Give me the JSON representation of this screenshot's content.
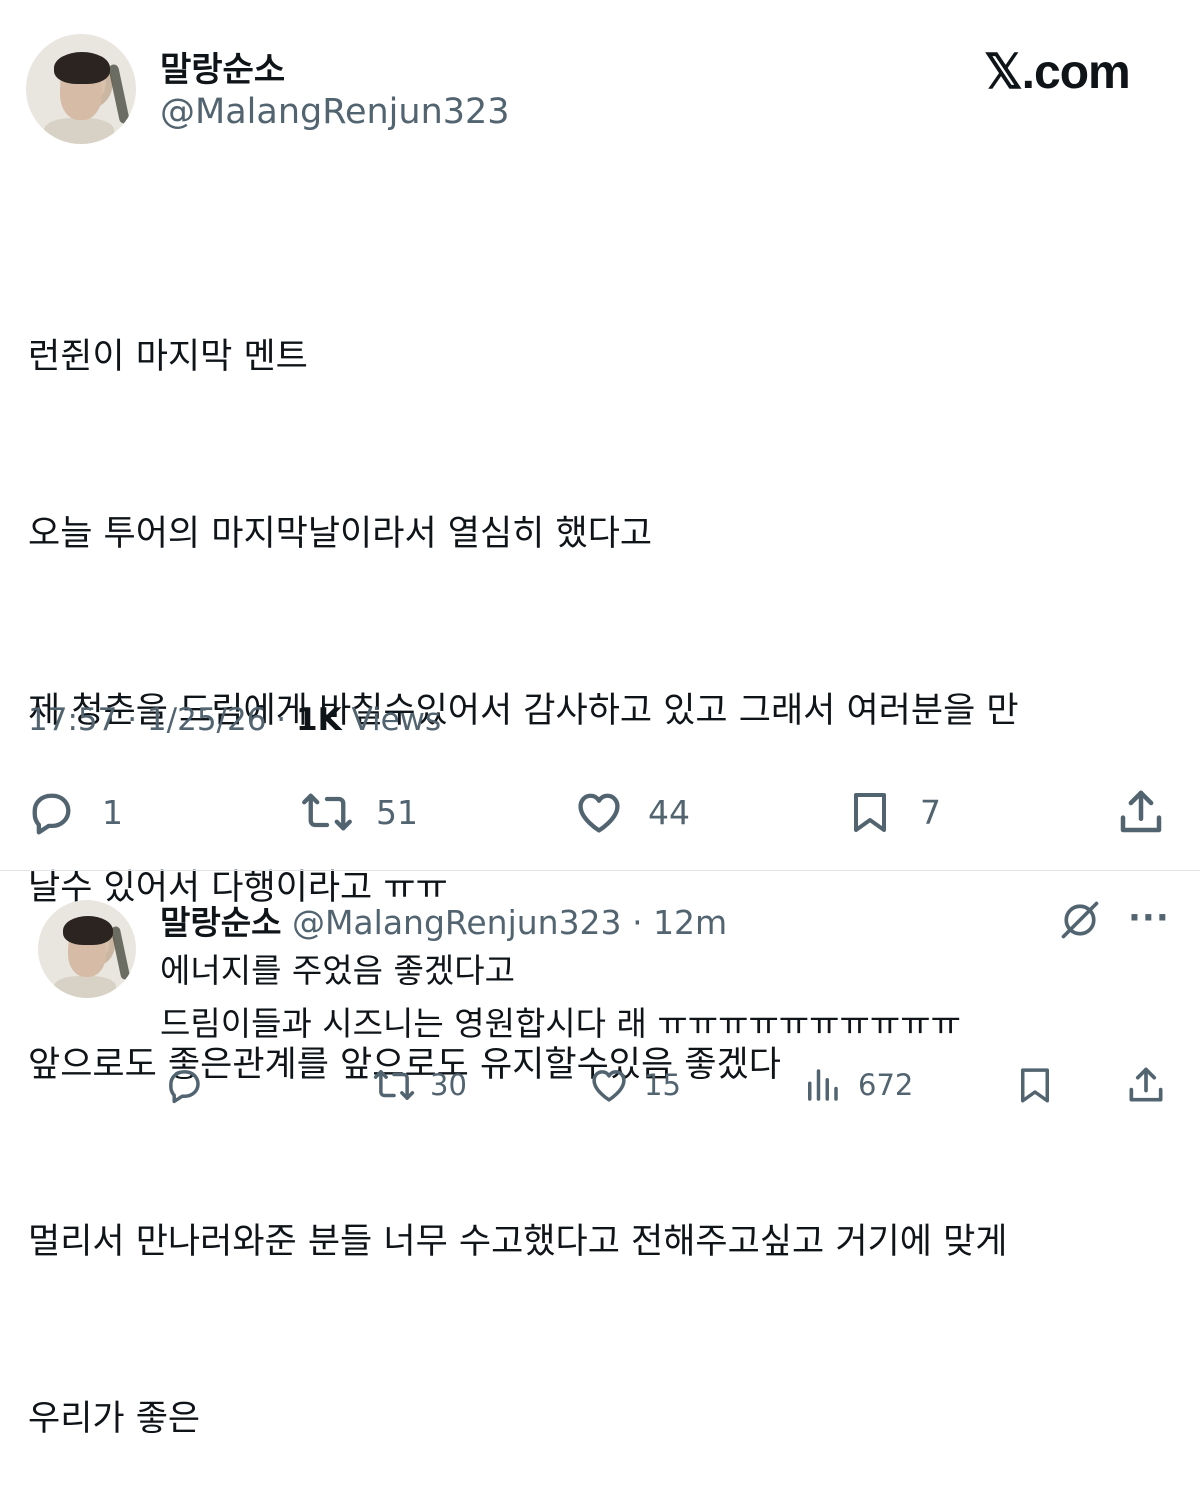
{
  "tweet": {
    "display_name": "말랑순소",
    "handle": "@MalangRenjun323",
    "brand": "𝕏.com",
    "lines": [
      "런쥔이 마지막 멘트",
      "오늘 투어의 마지막날이라서 열심히 했다고",
      "제 청춘을 드림에게 바칠수있어서 감사하고 있고 그래서 여러분을 만",
      "날수 있어서 다행이라고 ㅠㅠ",
      "앞으로도 좋은관계를 앞으로도 유지할수있음 좋겠다",
      "멀리서 만나러와준 분들 너무 수고했다고 전해주고싶고 거기에 맞게",
      "우리가 좋은"
    ],
    "time": "17:57",
    "date": "1/25/26",
    "views_count": "1K",
    "views_label": "Views",
    "replies": "1",
    "reposts": "51",
    "likes": "44",
    "bookmarks": "7"
  },
  "reply": {
    "display_name": "말랑순소",
    "handle": "@MalangRenjun323",
    "sep": "·",
    "age": "12m",
    "lines": [
      "에너지를 주었음 좋겠다고",
      "드림이들과 시즈니는 영원합시다 래 ㅠㅠㅠㅠㅠㅠㅠㅠㅠㅠ"
    ],
    "reposts": "30",
    "likes": "15",
    "views": "672",
    "more": "···"
  },
  "colors": {
    "text": "#0f1419",
    "secondary": "#536471",
    "divider": "#e1e5e8"
  }
}
